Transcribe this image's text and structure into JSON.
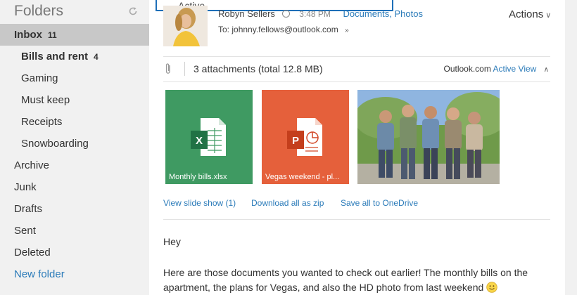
{
  "sidebar": {
    "title": "Folders",
    "refresh_icon": "refresh-icon",
    "folders": [
      {
        "label": "Inbox",
        "count": "11"
      },
      {
        "label": "Bills and rent",
        "count": "4"
      },
      {
        "label": "Gaming"
      },
      {
        "label": "Must keep"
      },
      {
        "label": "Receipts"
      },
      {
        "label": "Snowboarding"
      },
      {
        "label": "Archive"
      },
      {
        "label": "Junk"
      },
      {
        "label": "Drafts"
      },
      {
        "label": "Sent"
      },
      {
        "label": "Deleted"
      }
    ],
    "new_folder": "New folder"
  },
  "popup": {
    "text": "Active"
  },
  "message": {
    "sender": "Robyn Sellers",
    "time": "3:48 PM",
    "tags": "Documents, Photos",
    "to_label": "To:",
    "to_address": "johnny.fellows@outlook.com",
    "actions_label": "Actions"
  },
  "attachments": {
    "summary": "3 attachments (total 12.8 MB)",
    "service": "Outlook.com",
    "active_view": "Active View",
    "files": [
      {
        "name": "Monthly bills.xlsx",
        "type": "excel-icon"
      },
      {
        "name": "Vegas weekend - pl...",
        "type": "powerpoint-icon"
      },
      {
        "name": "",
        "type": "photo"
      }
    ],
    "links": {
      "slideshow": "View slide show (1)",
      "download_zip": "Download all as zip",
      "save_onedrive": "Save all to OneDrive"
    }
  },
  "body": {
    "greeting": "Hey",
    "text": "Here are those documents you wanted to check out earlier! The monthly bills on the apartment, the plans for Vegas, and also the HD photo from last weekend"
  },
  "colors": {
    "accent": "#2b7bb9",
    "excel": "#3f9a62",
    "powerpoint": "#e5603b",
    "sidebar_bg": "#f1f1f1",
    "selected_bg": "#c8c8c8"
  }
}
